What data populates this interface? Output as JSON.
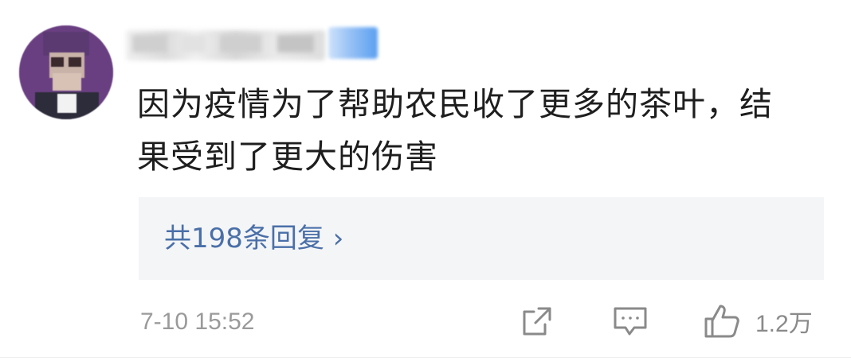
{
  "comment": {
    "text": "因为疫情为了帮助农民收了更多的茶叶，结果受到了更大的伤害",
    "replies_label": "共198条回复 ›",
    "timestamp": "7-10 15:52",
    "like_count": "1.2万"
  },
  "colors": {
    "link": "#4a6fa8",
    "muted": "#9a9a9a",
    "text": "#1e1e1e",
    "reply_bg": "#f4f5f7"
  },
  "icons": {
    "share": "share-icon",
    "comment": "comment-icon",
    "like": "thumbs-up-icon"
  }
}
